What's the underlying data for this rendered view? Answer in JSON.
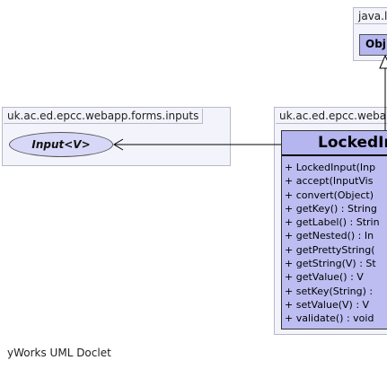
{
  "packages": {
    "java_lang": "java.l",
    "forms_inputs": "uk.ac.ed.epcc.webapp.forms.inputs",
    "webapp": "uk.ac.ed.epcc.webap"
  },
  "interface_name": "Input<V>",
  "object_class": "Obj",
  "main_class": {
    "name": "LockedIn",
    "methods": [
      "+ LockedInput(Inp",
      "+ accept(InputVis",
      "+ convert(Object)",
      "+ getKey() : String",
      "+ getLabel() : Strin",
      "+ getNested() : In",
      "+ getPrettyString(",
      "+ getString(V) : St",
      "+ getValue() : V",
      "+ setKey(String) :",
      "+ setValue(V) : V",
      "+ validate() : void"
    ]
  },
  "footer": "yWorks UML Doclet"
}
